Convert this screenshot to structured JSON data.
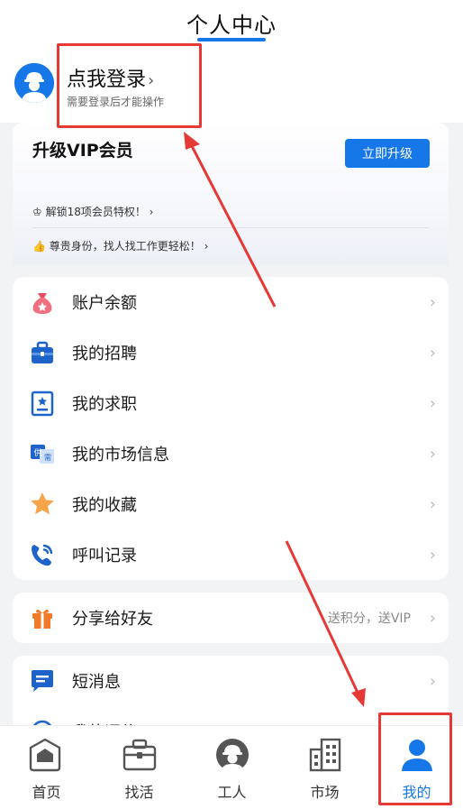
{
  "header": {
    "title": "个人中心"
  },
  "profile": {
    "login_title": "点我登录",
    "login_chevron": "›",
    "login_sub": "需要登录后才能操作"
  },
  "vip": {
    "title": "升级VIP会员",
    "button": "立即升级",
    "line1": "♔ 解锁18项会员特权！ ›",
    "line2": "👍 尊贵身份，找人找工作更轻松！ ›"
  },
  "menu": [
    {
      "label": "账户余额",
      "icon": "money-bag-icon"
    },
    {
      "label": "我的招聘",
      "icon": "briefcase-icon"
    },
    {
      "label": "我的求职",
      "icon": "resume-icon"
    },
    {
      "label": "我的市场信息",
      "icon": "supply-demand-icon"
    },
    {
      "label": "我的收藏",
      "icon": "star-icon"
    },
    {
      "label": "呼叫记录",
      "icon": "phone-icon"
    }
  ],
  "share": {
    "label": "分享给好友",
    "extra": "送积分，送VIP",
    "icon": "gift-icon"
  },
  "messages": [
    {
      "label": "短消息",
      "icon": "message-icon"
    },
    {
      "label": "我的评价",
      "icon": "review-icon"
    }
  ],
  "chevron": "›",
  "nav": [
    {
      "label": "首页",
      "icon": "home-icon"
    },
    {
      "label": "找活",
      "icon": "briefcase-icon"
    },
    {
      "label": "工人",
      "icon": "worker-icon"
    },
    {
      "label": "市场",
      "icon": "buildings-icon"
    },
    {
      "label": "我的",
      "icon": "profile-icon",
      "active": true
    }
  ],
  "colors": {
    "accent": "#1677e8",
    "highlight": "#e53935"
  }
}
